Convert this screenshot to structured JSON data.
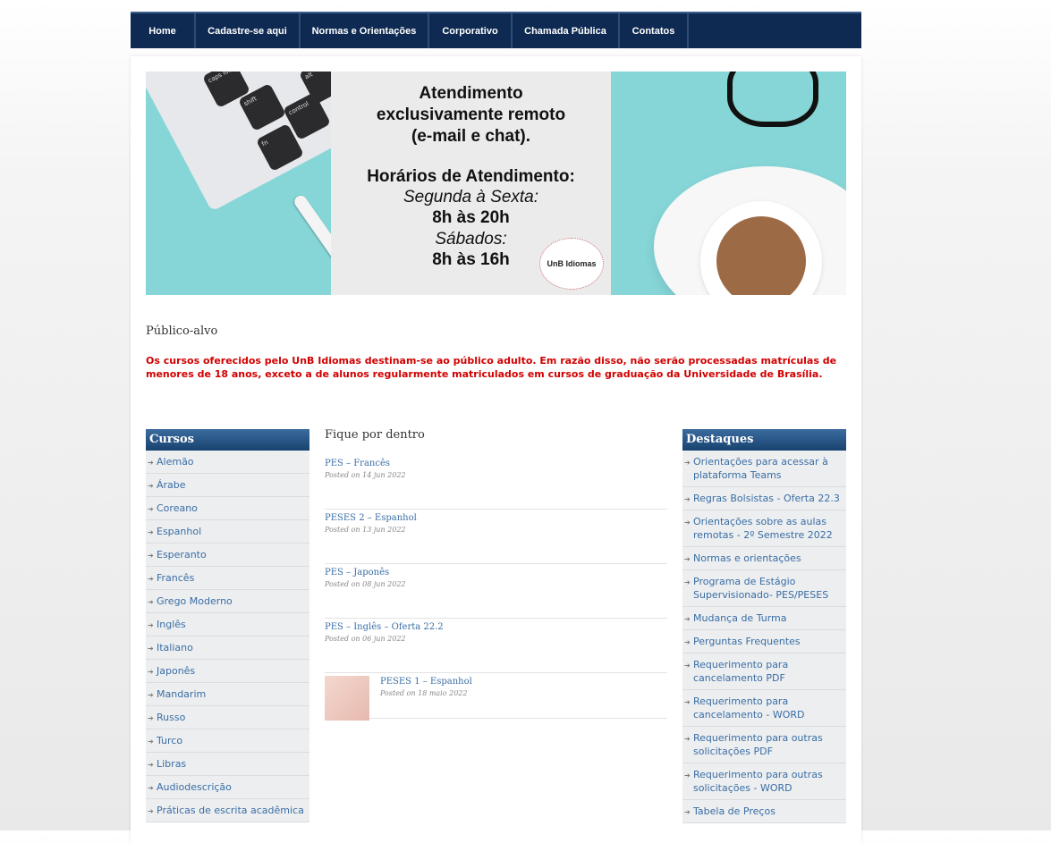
{
  "nav": {
    "items": [
      "Home",
      "Cadastre-se aqui",
      "Normas e Orientações",
      "Corporativo",
      "Chamada Pública",
      "Contatos"
    ]
  },
  "banner": {
    "line1": "Atendimento",
    "line2": "exclusivamente remoto",
    "line3": "(e-mail e chat).",
    "hours_title": "Horários de Atendimento:",
    "weekday_label": "Segunda à Sexta:",
    "weekday_hours": "8h às 20h",
    "saturday_label": "Sábados:",
    "saturday_hours": "8h às 16h",
    "logo_text": "UnB Idiomas",
    "keys": [
      "caps lock",
      "shift",
      "fn",
      "control",
      "alt"
    ]
  },
  "publico": {
    "title": "Público-alvo",
    "notice": "Os cursos oferecidos pelo UnB Idiomas destinam-se ao público adulto. Em razão disso, não serão processadas matrículas de menores de 18 anos, exceto a de alunos regularmente matriculados em cursos de graduação da Universidade de Brasília."
  },
  "cursos": {
    "title": "Cursos",
    "items": [
      "Alemão",
      "Árabe",
      "Coreano",
      "Espanhol",
      "Esperanto",
      "Francês",
      "Grego Moderno",
      "Inglês",
      "Italiano",
      "Japonês",
      "Mandarim",
      "Russo",
      "Turco",
      "Libras",
      "Audiodescrição",
      "Práticas de escrita acadêmica"
    ]
  },
  "fique": {
    "title": "Fique por dentro",
    "posts": [
      {
        "title": "PES – Francês",
        "date": "Posted on 14 jun 2022"
      },
      {
        "title": "PESES 2 – Espanhol",
        "date": "Posted on 13 jun 2022"
      },
      {
        "title": "PES – Japonês",
        "date": "Posted on 08 jun 2022"
      },
      {
        "title": "PES – Inglês – Oferta 22.2",
        "date": "Posted on 06 jun 2022"
      },
      {
        "title": "PESES 1 – Espanhol",
        "date": "Posted on 18 maio 2022"
      }
    ]
  },
  "destaques": {
    "title": "Destaques",
    "items": [
      "Orientações para acessar à plataforma Teams",
      "Regras Bolsistas - Oferta 22.3",
      "Orientações sobre as aulas remotas - 2º Semestre 2022",
      "Normas e orientações",
      "Programa de Estágio Supervisionado- PES/PESES",
      "Mudança de Turma",
      "Perguntas Frequentes",
      "Requerimento para cancelamento PDF",
      "Requerimento para cancelamento - WORD",
      "Requerimento para outras solicitações PDF",
      "Requerimento para outras solicitações - WORD",
      "Tabela de Preços"
    ]
  }
}
